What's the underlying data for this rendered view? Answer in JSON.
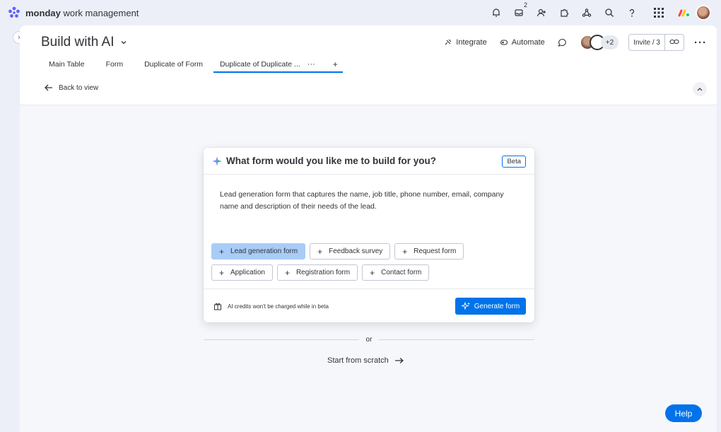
{
  "app": {
    "brand": "monday",
    "brand_suffix": "work management",
    "notifications_count": "2"
  },
  "board": {
    "title": "Build with AI",
    "actions": {
      "integrate": "Integrate",
      "automate": "Automate",
      "members_more": "+2",
      "invite": "Invite / 3"
    },
    "tabs": [
      {
        "label": "Main Table"
      },
      {
        "label": "Form"
      },
      {
        "label": "Duplicate of Form"
      },
      {
        "label": "Duplicate of Duplicate ..."
      }
    ],
    "back_label": "Back to view"
  },
  "ai_form": {
    "title": "What form would you like me to build for you?",
    "beta": "Beta",
    "prompt": "Lead generation form that captures the name, job title, phone number, email, company name and description of their needs of the lead.",
    "chips": [
      {
        "label": "Lead generation form",
        "selected": true
      },
      {
        "label": "Feedback survey",
        "selected": false
      },
      {
        "label": "Request form",
        "selected": false
      },
      {
        "label": "Application",
        "selected": false
      },
      {
        "label": "Registration form",
        "selected": false
      },
      {
        "label": "Contact form",
        "selected": false
      }
    ],
    "credits_note": "AI credits won't be charged while in beta",
    "generate_label": "Generate form"
  },
  "alt": {
    "or": "or",
    "scratch_label": "Start from scratch"
  },
  "help_label": "Help",
  "colors": {
    "primary": "#0073ea",
    "chip_selected": "#a9ccf7",
    "background": "#eceff8"
  }
}
